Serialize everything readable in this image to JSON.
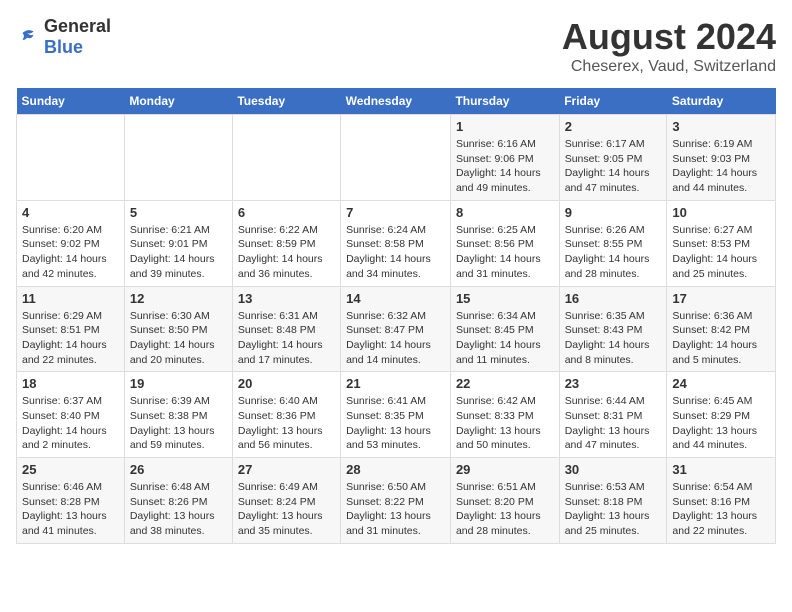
{
  "header": {
    "logo_general": "General",
    "logo_blue": "Blue",
    "main_title": "August 2024",
    "subtitle": "Cheserex, Vaud, Switzerland"
  },
  "days_of_week": [
    "Sunday",
    "Monday",
    "Tuesday",
    "Wednesday",
    "Thursday",
    "Friday",
    "Saturday"
  ],
  "weeks": [
    {
      "days": [
        {
          "num": "",
          "info": ""
        },
        {
          "num": "",
          "info": ""
        },
        {
          "num": "",
          "info": ""
        },
        {
          "num": "",
          "info": ""
        },
        {
          "num": "1",
          "info": "Sunrise: 6:16 AM\nSunset: 9:06 PM\nDaylight: 14 hours\nand 49 minutes."
        },
        {
          "num": "2",
          "info": "Sunrise: 6:17 AM\nSunset: 9:05 PM\nDaylight: 14 hours\nand 47 minutes."
        },
        {
          "num": "3",
          "info": "Sunrise: 6:19 AM\nSunset: 9:03 PM\nDaylight: 14 hours\nand 44 minutes."
        }
      ]
    },
    {
      "days": [
        {
          "num": "4",
          "info": "Sunrise: 6:20 AM\nSunset: 9:02 PM\nDaylight: 14 hours\nand 42 minutes."
        },
        {
          "num": "5",
          "info": "Sunrise: 6:21 AM\nSunset: 9:01 PM\nDaylight: 14 hours\nand 39 minutes."
        },
        {
          "num": "6",
          "info": "Sunrise: 6:22 AM\nSunset: 8:59 PM\nDaylight: 14 hours\nand 36 minutes."
        },
        {
          "num": "7",
          "info": "Sunrise: 6:24 AM\nSunset: 8:58 PM\nDaylight: 14 hours\nand 34 minutes."
        },
        {
          "num": "8",
          "info": "Sunrise: 6:25 AM\nSunset: 8:56 PM\nDaylight: 14 hours\nand 31 minutes."
        },
        {
          "num": "9",
          "info": "Sunrise: 6:26 AM\nSunset: 8:55 PM\nDaylight: 14 hours\nand 28 minutes."
        },
        {
          "num": "10",
          "info": "Sunrise: 6:27 AM\nSunset: 8:53 PM\nDaylight: 14 hours\nand 25 minutes."
        }
      ]
    },
    {
      "days": [
        {
          "num": "11",
          "info": "Sunrise: 6:29 AM\nSunset: 8:51 PM\nDaylight: 14 hours\nand 22 minutes."
        },
        {
          "num": "12",
          "info": "Sunrise: 6:30 AM\nSunset: 8:50 PM\nDaylight: 14 hours\nand 20 minutes."
        },
        {
          "num": "13",
          "info": "Sunrise: 6:31 AM\nSunset: 8:48 PM\nDaylight: 14 hours\nand 17 minutes."
        },
        {
          "num": "14",
          "info": "Sunrise: 6:32 AM\nSunset: 8:47 PM\nDaylight: 14 hours\nand 14 minutes."
        },
        {
          "num": "15",
          "info": "Sunrise: 6:34 AM\nSunset: 8:45 PM\nDaylight: 14 hours\nand 11 minutes."
        },
        {
          "num": "16",
          "info": "Sunrise: 6:35 AM\nSunset: 8:43 PM\nDaylight: 14 hours\nand 8 minutes."
        },
        {
          "num": "17",
          "info": "Sunrise: 6:36 AM\nSunset: 8:42 PM\nDaylight: 14 hours\nand 5 minutes."
        }
      ]
    },
    {
      "days": [
        {
          "num": "18",
          "info": "Sunrise: 6:37 AM\nSunset: 8:40 PM\nDaylight: 14 hours\nand 2 minutes."
        },
        {
          "num": "19",
          "info": "Sunrise: 6:39 AM\nSunset: 8:38 PM\nDaylight: 13 hours\nand 59 minutes."
        },
        {
          "num": "20",
          "info": "Sunrise: 6:40 AM\nSunset: 8:36 PM\nDaylight: 13 hours\nand 56 minutes."
        },
        {
          "num": "21",
          "info": "Sunrise: 6:41 AM\nSunset: 8:35 PM\nDaylight: 13 hours\nand 53 minutes."
        },
        {
          "num": "22",
          "info": "Sunrise: 6:42 AM\nSunset: 8:33 PM\nDaylight: 13 hours\nand 50 minutes."
        },
        {
          "num": "23",
          "info": "Sunrise: 6:44 AM\nSunset: 8:31 PM\nDaylight: 13 hours\nand 47 minutes."
        },
        {
          "num": "24",
          "info": "Sunrise: 6:45 AM\nSunset: 8:29 PM\nDaylight: 13 hours\nand 44 minutes."
        }
      ]
    },
    {
      "days": [
        {
          "num": "25",
          "info": "Sunrise: 6:46 AM\nSunset: 8:28 PM\nDaylight: 13 hours\nand 41 minutes."
        },
        {
          "num": "26",
          "info": "Sunrise: 6:48 AM\nSunset: 8:26 PM\nDaylight: 13 hours\nand 38 minutes."
        },
        {
          "num": "27",
          "info": "Sunrise: 6:49 AM\nSunset: 8:24 PM\nDaylight: 13 hours\nand 35 minutes."
        },
        {
          "num": "28",
          "info": "Sunrise: 6:50 AM\nSunset: 8:22 PM\nDaylight: 13 hours\nand 31 minutes."
        },
        {
          "num": "29",
          "info": "Sunrise: 6:51 AM\nSunset: 8:20 PM\nDaylight: 13 hours\nand 28 minutes."
        },
        {
          "num": "30",
          "info": "Sunrise: 6:53 AM\nSunset: 8:18 PM\nDaylight: 13 hours\nand 25 minutes."
        },
        {
          "num": "31",
          "info": "Sunrise: 6:54 AM\nSunset: 8:16 PM\nDaylight: 13 hours\nand 22 minutes."
        }
      ]
    }
  ]
}
